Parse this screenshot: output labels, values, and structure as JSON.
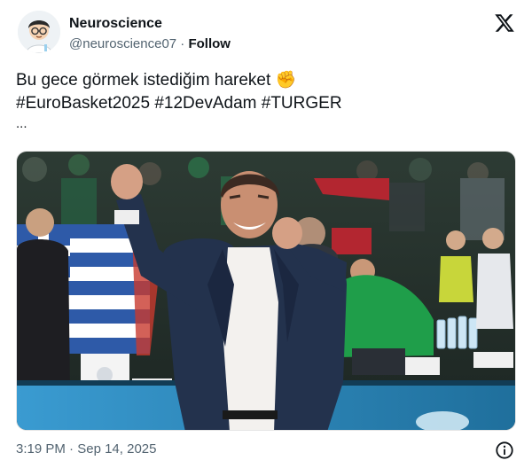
{
  "user": {
    "name": "Neuroscience",
    "handle": "@neuroscience07",
    "separator": " · ",
    "follow_label": "Follow"
  },
  "tweet": {
    "line1": "Bu gece görmek istediğim hareket ",
    "emoji": "✊",
    "hashtags": [
      "#EuroBasket2025",
      "#12DevAdam",
      "#TURGER"
    ],
    "ellipsis": "..."
  },
  "media": {
    "icon": "photo-of-coach-celebrating-with-raised-fists"
  },
  "meta": {
    "time": "3:19 PM",
    "separator": " · ",
    "date": "Sep 14, 2025"
  },
  "icons": {
    "logo": "x-logo-icon",
    "info": "info-icon"
  },
  "colors": {
    "text": "#0f1419",
    "secondary": "#536471",
    "court_blue": "#2b8cc4",
    "green_jersey": "#1f9e4a"
  }
}
